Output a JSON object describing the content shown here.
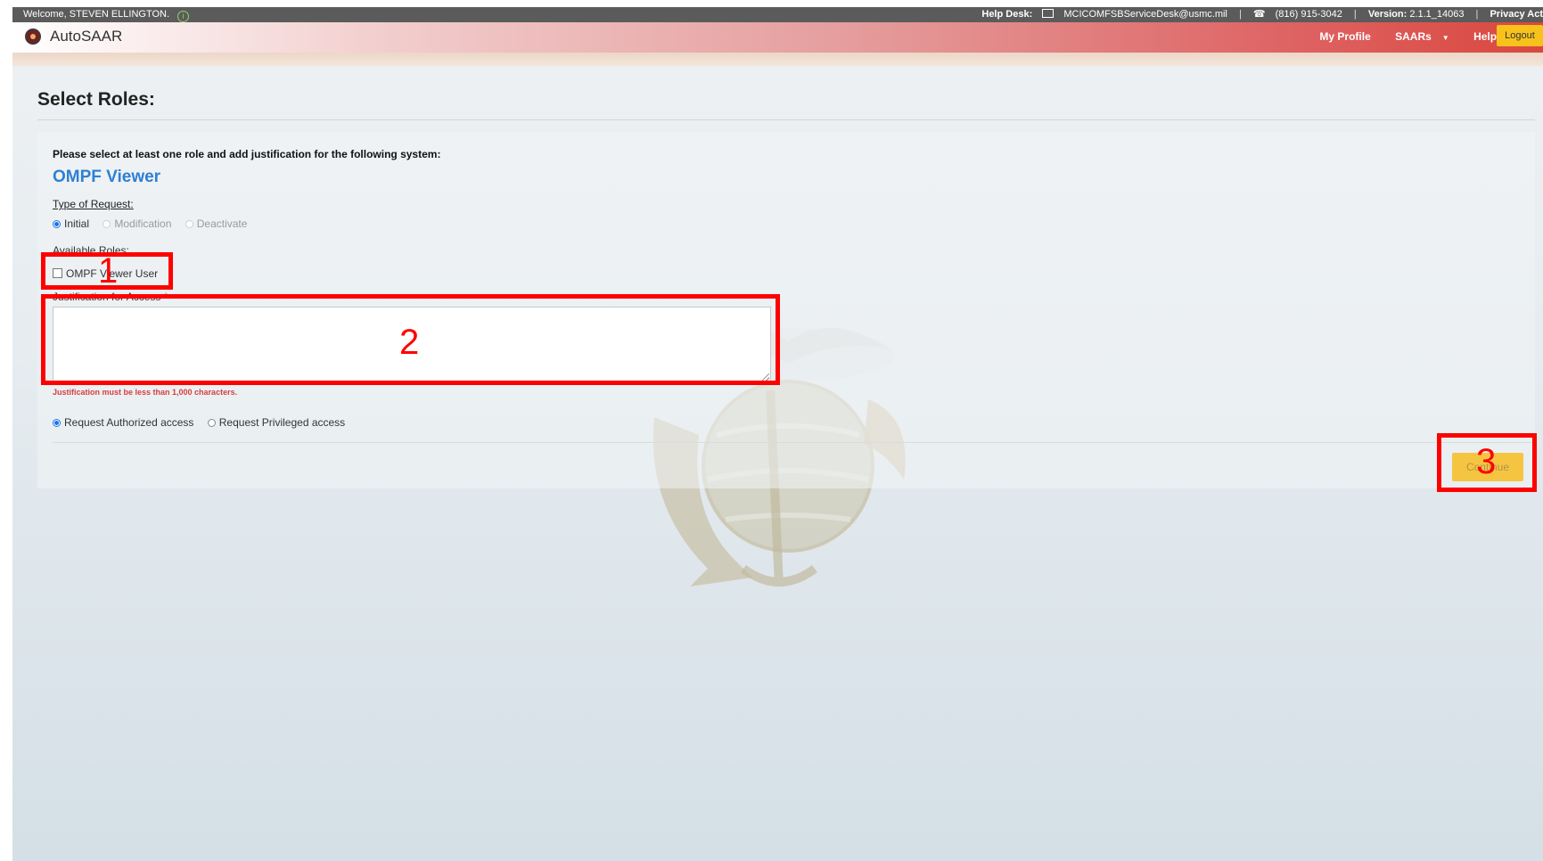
{
  "topbar": {
    "welcome": "Welcome, STEVEN ELLINGTON.",
    "helpdesk_label": "Help Desk:",
    "email": "MCICOMFSBServiceDesk@usmc.mil",
    "phone": "(816) 915-3042",
    "version_label": "Version:",
    "version": "2.1.1_14063",
    "privacy": "Privacy Act"
  },
  "header": {
    "app_name": "AutoSAAR",
    "nav": {
      "my_profile": "My Profile",
      "saars": "SAARs",
      "help": "Help"
    },
    "logout": "Logout"
  },
  "page": {
    "title": "Select Roles:",
    "prompt": "Please select at least one role and add justification for the following system:",
    "system_name": "OMPF Viewer",
    "type_label": "Type of Request:",
    "request_types": {
      "initial": "Initial",
      "modification": "Modification",
      "deactivate": "Deactivate"
    },
    "roles_label": "Available Roles:",
    "role": "OMPF Viewer User",
    "justification_label": "Justification for Access",
    "required_mark": "*",
    "char_note": "Justification must be less than 1,000 characters.",
    "access_authorized": "Request Authorized access",
    "access_privileged": "Request Privileged access",
    "continue": "Continue"
  },
  "annotations": {
    "n1": "1",
    "n2": "2",
    "n3": "3"
  }
}
